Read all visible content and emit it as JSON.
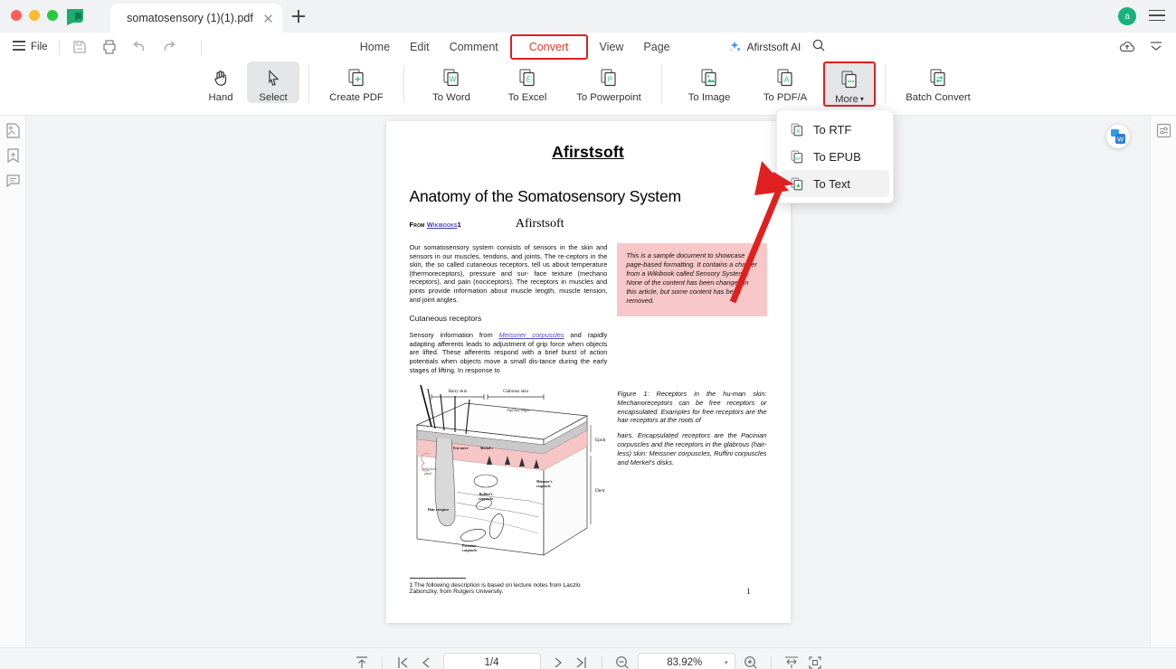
{
  "window": {
    "app_logo": "afirstsoft-logo",
    "tab_title": "somatosensory (1)(1).pdf",
    "avatar_initial": "a"
  },
  "menubar": {
    "file_label": "File",
    "quick_icons": [
      "save-icon",
      "print-icon",
      "undo-icon",
      "redo-icon"
    ],
    "tabs": [
      {
        "label": "Home",
        "active": false
      },
      {
        "label": "Edit",
        "active": false
      },
      {
        "label": "Comment",
        "active": false
      },
      {
        "label": "Convert",
        "active": true
      },
      {
        "label": "View",
        "active": false
      },
      {
        "label": "Page",
        "active": false
      }
    ],
    "ai_label": "Afirstsoft AI",
    "search_icon": "search-icon",
    "right_icons": [
      "cloud-upload-icon",
      "collapse-ribbon-icon"
    ]
  },
  "ribbon": {
    "buttons": [
      {
        "label": "Hand",
        "icon": "hand-icon",
        "selected": false,
        "highlighted": false
      },
      {
        "label": "Select",
        "icon": "cursor-arrow-icon",
        "selected": true,
        "highlighted": false
      },
      {
        "label": "Create PDF",
        "icon": "create-pdf-icon",
        "selected": false,
        "highlighted": false
      },
      {
        "label": "To Word",
        "icon": "to-word-icon",
        "selected": false,
        "highlighted": false
      },
      {
        "label": "To Excel",
        "icon": "to-excel-icon",
        "selected": false,
        "highlighted": false
      },
      {
        "label": "To Powerpoint",
        "icon": "to-powerpoint-icon",
        "selected": false,
        "highlighted": false
      },
      {
        "label": "To Image",
        "icon": "to-image-icon",
        "selected": false,
        "highlighted": false
      },
      {
        "label": "To PDF/A",
        "icon": "to-pdfa-icon",
        "selected": false,
        "highlighted": false
      },
      {
        "label": "More",
        "icon": "more-convert-icon",
        "selected": true,
        "highlighted": true,
        "caret": "▾"
      },
      {
        "label": "Batch Convert",
        "icon": "batch-convert-icon",
        "selected": false,
        "highlighted": false
      }
    ]
  },
  "dropdown": {
    "open": true,
    "items": [
      {
        "label": "To RTF",
        "icon": "rtf-file-icon",
        "hover": false
      },
      {
        "label": "To EPUB",
        "icon": "epub-file-icon",
        "hover": false
      },
      {
        "label": "To Text",
        "icon": "text-file-icon",
        "hover": true
      }
    ]
  },
  "left_rail": {
    "items": [
      {
        "icon": "thumbnail-panel-icon"
      },
      {
        "icon": "bookmark-panel-icon"
      },
      {
        "icon": "comment-panel-icon"
      }
    ]
  },
  "right_rail": {
    "items": [
      {
        "icon": "properties-panel-icon"
      }
    ]
  },
  "canvas": {
    "float_button": "convert-to-word-floating-button"
  },
  "document": {
    "brand_heading": "Afirstsoft",
    "title": "Anatomy of the Somatosensory System",
    "from_prefix": "From ",
    "from_link": "Wikibooks",
    "from_suffix": "1",
    "serif_brand": "Afirstsoft",
    "body_paragraph": "Our somatosensory system consists of sensors in the skin and sensors in our muscles, tendons, and joints. The re-ceptors in the skin, the so called cutaneous receptors, tell us about temperature (thermoreceptors), pressure and sur- face texture (mechano receptors), and pain (nociceptors). The receptors in muscles and joints provide information about muscle length, muscle tension, and joint angles.",
    "section_heading": "Cutaneous receptors",
    "second_paragraph_pre": "Sensory information from ",
    "second_paragraph_link": "Meissner corpuscles",
    "second_paragraph_post": " and rapidly adapting afferents leads to adjustment of grip force when objects are lifted. These afferents respond with a brief burst of action potentials when objects move a small dis-tance during the early stages of lifting. In response to",
    "callout": "This is a sample document to showcase page-based formatting. It contains a chapter from a Wikibook called Sensory Systems. None of the content has been changed in this article, but some content has been removed.",
    "figure_caption_1": "Figure 1: Receptors in the hu-man skin: Mechanoreceptors can be free receptors or encapsulated. Examples for free receptors are the hair receptors at the roots of",
    "figure_caption_2": "hairs. Encapsulated receptors are the Pacinian corpuscles and the receptors in the glabrous (hair- less) skin: Meissner corpuscles, Ruffini corpuscles and Merkel's disks.",
    "footnote": "1 The following description is based on lecture notes from Laszlo Zaborszky, from Rutgers University.",
    "page_number": "1",
    "figure_labels": {
      "hairy_skin": "Hairy skin",
      "glabrous_skin": "Glabrous skin",
      "papillary_ridges": "Papillary ridges",
      "epidermis": "Epidermis",
      "dermis": "Dermis",
      "sebaceous_gland": "Sebaceous gland",
      "hair_receptor": "Hair receptor",
      "meissner": "Meissner's corpuscle",
      "ruffini": "Ruffini's corpuscle",
      "pacinian": "Pacinian corpuscle",
      "merkel": "Merkel's receptor",
      "free_nerve": "Free nerve ending"
    }
  },
  "statusbar": {
    "first_icon": "fit-top-icon",
    "first_page_icon": "first-page-icon",
    "prev_page_icon": "prev-page-icon",
    "page_value": "1/4",
    "next_page_icon": "next-page-icon",
    "last_page_icon": "last-page-icon",
    "zoom_out_icon": "zoom-out-icon",
    "zoom_value": "83.92%",
    "zoom_caret": "▾",
    "zoom_in_icon": "zoom-in-icon",
    "fit_width_icon": "fit-width-icon",
    "fit_page_icon": "fit-page-icon"
  },
  "colors": {
    "accent_red": "#e13b32",
    "highlight_red": "#e02020",
    "brand_green": "#18b27a",
    "callout_pink": "#f8c8c8",
    "canvas_grey": "#f2f3f5"
  }
}
